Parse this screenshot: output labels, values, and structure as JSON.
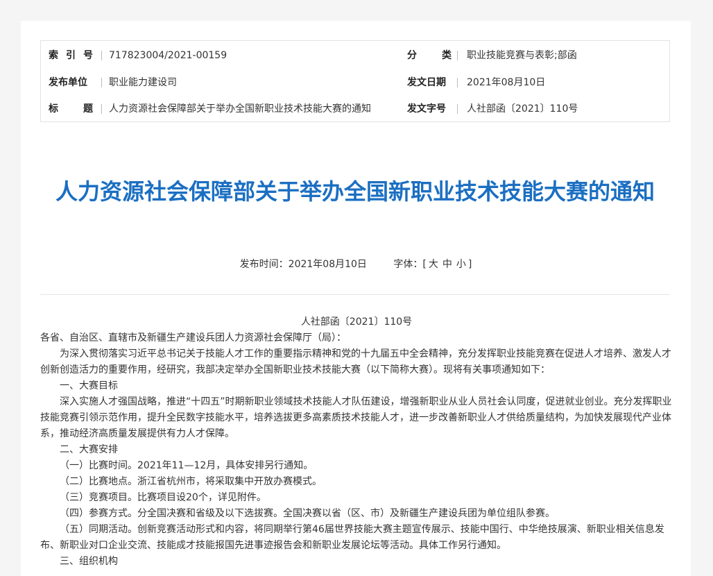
{
  "meta": {
    "rows": [
      {
        "left_label": "索引号",
        "left_value": "717823004/2021-00159",
        "right_label": "分类",
        "right_value": "职业技能竞赛与表彰;部函"
      },
      {
        "left_label": "发布单位",
        "left_value": "职业能力建设司",
        "right_label": "发文日期",
        "right_value": "2021年08月10日"
      },
      {
        "left_label": "标题",
        "left_value": "人力资源社会保障部关于举办全国新职业技术技能大赛的通知",
        "right_label": "发文字号",
        "right_value": "人社部函〔2021〕110号"
      }
    ]
  },
  "article": {
    "title": "人力资源社会保障部关于举办全国新职业技术技能大赛的通知",
    "publish_label": "发布时间：",
    "publish_date": "2021年08月10日",
    "font_label": "字体：[",
    "font_large": "大",
    "font_medium": "中",
    "font_small": "小",
    "font_close": "]",
    "doc_number": "人社部函〔2021〕110号",
    "addressee": "各省、自治区、直辖市及新疆生产建设兵团人力资源社会保障厅（局）：",
    "p1": "为深入贯彻落实习近平总书记关于技能人才工作的重要指示精神和党的十九届五中全会精神，充分发挥职业技能竞赛在促进人才培养、激发人才创新创造活力的重要作用，经研究，我部决定举办全国新职业技术技能大赛（以下简称大赛）。现将有关事项通知如下：",
    "s1": "一、大赛目标",
    "p2": "深入实施人才强国战略，推进“十四五”时期新职业领域技术技能人才队伍建设，增强新职业从业人员社会认同度，促进就业创业。充分发挥职业技能竞赛引领示范作用，提升全民数字技能水平，培养选拔更多高素质技术技能人才，进一步改善新职业人才供给质量结构，为加快发展现代产业体系，推动经济高质量发展提供有力人才保障。",
    "s2": "二、大赛安排",
    "i1": "（一）比赛时间。2021年11—12月，具体安排另行通知。",
    "i2": "（二）比赛地点。浙江省杭州市，将采取集中开放办赛模式。",
    "i3": "（三）竞赛项目。比赛项目设20个，详见附件。",
    "i4": "（四）参赛方式。分全国决赛和省级及以下选拔赛。全国决赛以省（区、市）及新疆生产建设兵团为单位组队参赛。",
    "i5": "（五）同期活动。创新竞赛活动形式和内容，将同期举行第46届世界技能大赛主题宣传展示、技能中国行、中华绝技展演、新职业相关信息发布、新职业对口企业交流、技能成才技能报国先进事迹报告会和新职业发展论坛等活动。具体工作另行通知。",
    "s3": "三、组织机构"
  }
}
